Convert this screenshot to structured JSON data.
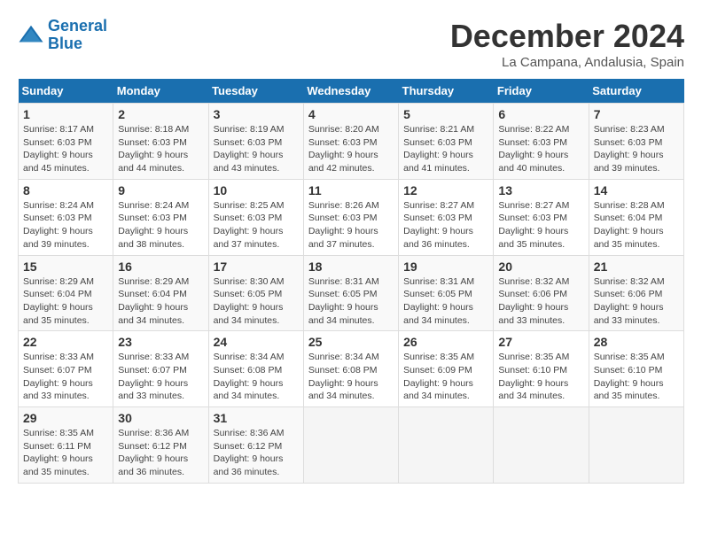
{
  "logo": {
    "line1": "General",
    "line2": "Blue"
  },
  "title": "December 2024",
  "subtitle": "La Campana, Andalusia, Spain",
  "days_of_week": [
    "Sunday",
    "Monday",
    "Tuesday",
    "Wednesday",
    "Thursday",
    "Friday",
    "Saturday"
  ],
  "weeks": [
    [
      {
        "day": "1",
        "sunrise": "8:17 AM",
        "sunset": "6:03 PM",
        "daylight": "9 hours and 45 minutes."
      },
      {
        "day": "2",
        "sunrise": "8:18 AM",
        "sunset": "6:03 PM",
        "daylight": "9 hours and 44 minutes."
      },
      {
        "day": "3",
        "sunrise": "8:19 AM",
        "sunset": "6:03 PM",
        "daylight": "9 hours and 43 minutes."
      },
      {
        "day": "4",
        "sunrise": "8:20 AM",
        "sunset": "6:03 PM",
        "daylight": "9 hours and 42 minutes."
      },
      {
        "day": "5",
        "sunrise": "8:21 AM",
        "sunset": "6:03 PM",
        "daylight": "9 hours and 41 minutes."
      },
      {
        "day": "6",
        "sunrise": "8:22 AM",
        "sunset": "6:03 PM",
        "daylight": "9 hours and 40 minutes."
      },
      {
        "day": "7",
        "sunrise": "8:23 AM",
        "sunset": "6:03 PM",
        "daylight": "9 hours and 39 minutes."
      }
    ],
    [
      {
        "day": "8",
        "sunrise": "8:24 AM",
        "sunset": "6:03 PM",
        "daylight": "9 hours and 39 minutes."
      },
      {
        "day": "9",
        "sunrise": "8:24 AM",
        "sunset": "6:03 PM",
        "daylight": "9 hours and 38 minutes."
      },
      {
        "day": "10",
        "sunrise": "8:25 AM",
        "sunset": "6:03 PM",
        "daylight": "9 hours and 37 minutes."
      },
      {
        "day": "11",
        "sunrise": "8:26 AM",
        "sunset": "6:03 PM",
        "daylight": "9 hours and 37 minutes."
      },
      {
        "day": "12",
        "sunrise": "8:27 AM",
        "sunset": "6:03 PM",
        "daylight": "9 hours and 36 minutes."
      },
      {
        "day": "13",
        "sunrise": "8:27 AM",
        "sunset": "6:03 PM",
        "daylight": "9 hours and 35 minutes."
      },
      {
        "day": "14",
        "sunrise": "8:28 AM",
        "sunset": "6:04 PM",
        "daylight": "9 hours and 35 minutes."
      }
    ],
    [
      {
        "day": "15",
        "sunrise": "8:29 AM",
        "sunset": "6:04 PM",
        "daylight": "9 hours and 35 minutes."
      },
      {
        "day": "16",
        "sunrise": "8:29 AM",
        "sunset": "6:04 PM",
        "daylight": "9 hours and 34 minutes."
      },
      {
        "day": "17",
        "sunrise": "8:30 AM",
        "sunset": "6:05 PM",
        "daylight": "9 hours and 34 minutes."
      },
      {
        "day": "18",
        "sunrise": "8:31 AM",
        "sunset": "6:05 PM",
        "daylight": "9 hours and 34 minutes."
      },
      {
        "day": "19",
        "sunrise": "8:31 AM",
        "sunset": "6:05 PM",
        "daylight": "9 hours and 34 minutes."
      },
      {
        "day": "20",
        "sunrise": "8:32 AM",
        "sunset": "6:06 PM",
        "daylight": "9 hours and 33 minutes."
      },
      {
        "day": "21",
        "sunrise": "8:32 AM",
        "sunset": "6:06 PM",
        "daylight": "9 hours and 33 minutes."
      }
    ],
    [
      {
        "day": "22",
        "sunrise": "8:33 AM",
        "sunset": "6:07 PM",
        "daylight": "9 hours and 33 minutes."
      },
      {
        "day": "23",
        "sunrise": "8:33 AM",
        "sunset": "6:07 PM",
        "daylight": "9 hours and 33 minutes."
      },
      {
        "day": "24",
        "sunrise": "8:34 AM",
        "sunset": "6:08 PM",
        "daylight": "9 hours and 34 minutes."
      },
      {
        "day": "25",
        "sunrise": "8:34 AM",
        "sunset": "6:08 PM",
        "daylight": "9 hours and 34 minutes."
      },
      {
        "day": "26",
        "sunrise": "8:35 AM",
        "sunset": "6:09 PM",
        "daylight": "9 hours and 34 minutes."
      },
      {
        "day": "27",
        "sunrise": "8:35 AM",
        "sunset": "6:10 PM",
        "daylight": "9 hours and 34 minutes."
      },
      {
        "day": "28",
        "sunrise": "8:35 AM",
        "sunset": "6:10 PM",
        "daylight": "9 hours and 35 minutes."
      }
    ],
    [
      {
        "day": "29",
        "sunrise": "8:35 AM",
        "sunset": "6:11 PM",
        "daylight": "9 hours and 35 minutes."
      },
      {
        "day": "30",
        "sunrise": "8:36 AM",
        "sunset": "6:12 PM",
        "daylight": "9 hours and 36 minutes."
      },
      {
        "day": "31",
        "sunrise": "8:36 AM",
        "sunset": "6:12 PM",
        "daylight": "9 hours and 36 minutes."
      },
      null,
      null,
      null,
      null
    ]
  ]
}
